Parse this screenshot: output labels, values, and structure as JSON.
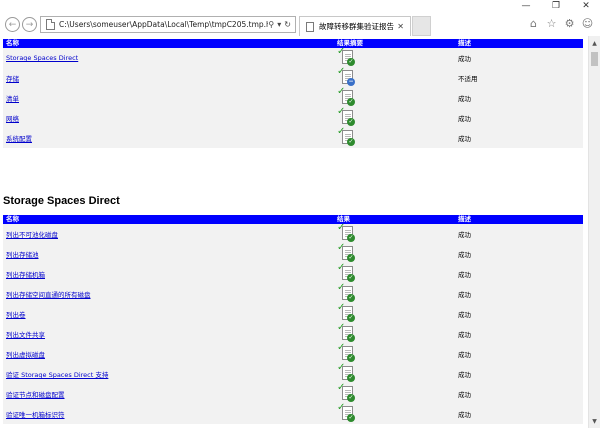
{
  "window": {
    "minimize": "—",
    "restore": "❐",
    "close": "✕"
  },
  "address_bar": {
    "url": "C:\\Users\\someuser\\AppData\\Local\\Temp\\tmpC205.tmp.htm",
    "search_glyph": "⚲",
    "dropdown_glyph": "▾",
    "refresh_glyph": "↻"
  },
  "nav": {
    "back": "←",
    "forward": "→"
  },
  "tab": {
    "label": "故障转移群集验证报告",
    "close": "✕"
  },
  "toolbar_icons": {
    "home": "⌂",
    "favorites": "☆",
    "settings": "⚙",
    "feedback": "☺"
  },
  "summary_table": {
    "headers": [
      "名称",
      "结果摘要",
      "描述"
    ],
    "rows": [
      {
        "name": "Storage Spaces Direct",
        "status": "ok",
        "desc": "成功"
      },
      {
        "name": "存储",
        "status": "na",
        "desc": "不适用"
      },
      {
        "name": "清单",
        "status": "ok",
        "desc": "成功"
      },
      {
        "name": "网络",
        "status": "ok",
        "desc": "成功"
      },
      {
        "name": "系统配置",
        "status": "ok",
        "desc": "成功"
      }
    ]
  },
  "section_title": "Storage Spaces Direct",
  "detail_table": {
    "headers": [
      "名称",
      "结果",
      "描述"
    ],
    "rows": [
      {
        "name": "列出不可池化磁盘",
        "status": "ok",
        "desc": "成功"
      },
      {
        "name": "列出存储池",
        "status": "ok",
        "desc": "成功"
      },
      {
        "name": "列出存储机箱",
        "status": "ok",
        "desc": "成功"
      },
      {
        "name": "列出存储空间直通的所有磁盘",
        "status": "ok",
        "desc": "成功"
      },
      {
        "name": "列出卷",
        "status": "ok",
        "desc": "成功"
      },
      {
        "name": "列出文件共享",
        "status": "ok",
        "desc": "成功"
      },
      {
        "name": "列出虚拟磁盘",
        "status": "ok",
        "desc": "成功"
      },
      {
        "name": "验证 Storage Spaces Direct 支持",
        "status": "ok",
        "desc": "成功"
      },
      {
        "name": "验证节点和磁盘配置",
        "status": "ok",
        "desc": "成功"
      },
      {
        "name": "验证唯一机箱标识符",
        "status": "ok",
        "desc": "成功"
      }
    ]
  },
  "status_marks": {
    "ok": "✓",
    "na": "−",
    "tick": "✓"
  },
  "scrollbar": {
    "up": "▲",
    "down": "▼"
  }
}
